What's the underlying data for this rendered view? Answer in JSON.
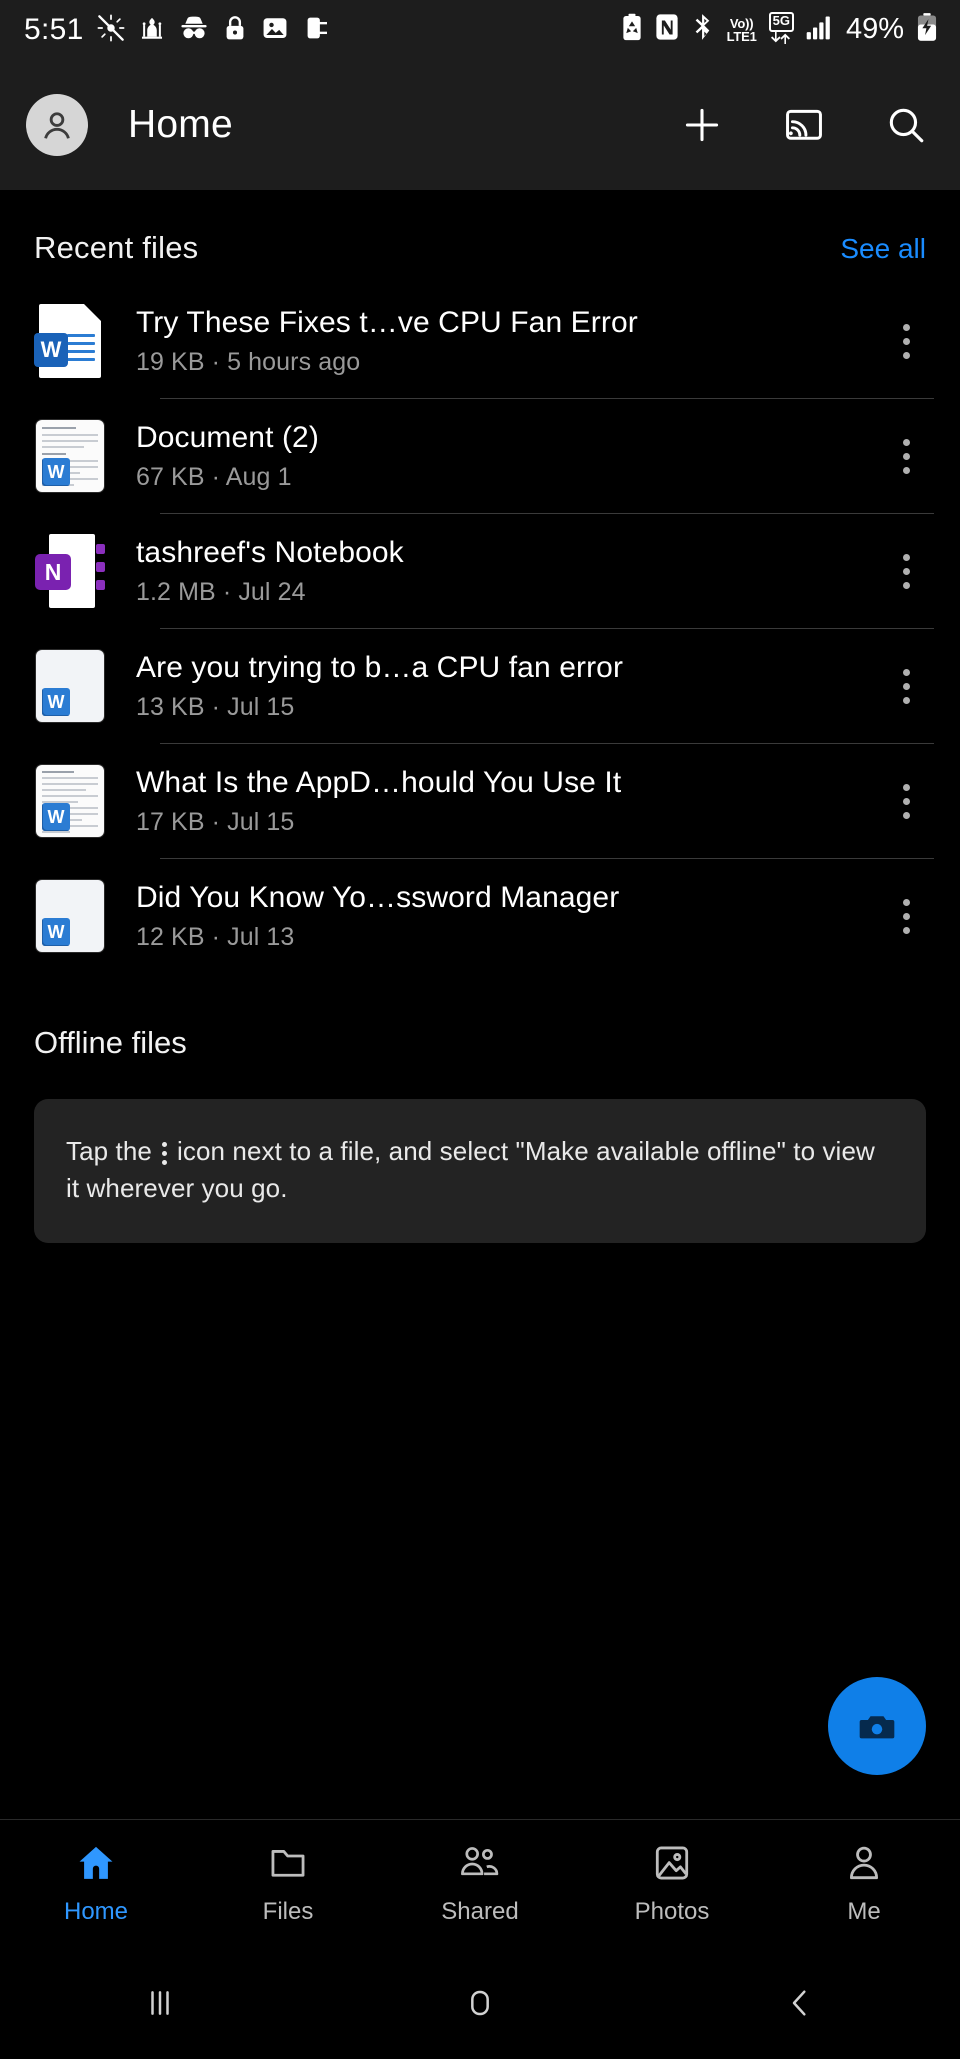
{
  "status_bar": {
    "time": "5:51",
    "battery_percent": "49%",
    "network_volte": "Vo))",
    "network_lte": "LTE1",
    "network_5g": "5G",
    "icons": [
      "do-not-disturb-icon",
      "mosque-icon",
      "incognito-icon",
      "lock-icon",
      "screenshot-icon",
      "phone-link-icon",
      "battery-saver-icon",
      "nfc-icon",
      "bluetooth-icon",
      "signal-bars-icon",
      "battery-charging-icon"
    ]
  },
  "app_bar": {
    "title": "Home",
    "avatar_name": "account-avatar",
    "actions": [
      "add-button",
      "cast-button",
      "search-button"
    ]
  },
  "recent": {
    "title": "Recent files",
    "see_all_label": "See all",
    "files": [
      {
        "name": "Try These Fixes t…ve CPU Fan Error",
        "size": "19 KB",
        "modified": "5 hours ago",
        "sub": "19 KB · 5 hours ago",
        "icon": "word-document-icon",
        "badge": "W"
      },
      {
        "name": "Document (2)",
        "size": "67 KB",
        "modified": "Aug 1",
        "sub": "67 KB · Aug 1",
        "icon": "word-thumbnail-icon",
        "badge": "W"
      },
      {
        "name": "tashreef's Notebook",
        "size": "1.2 MB",
        "modified": "Jul 24",
        "sub": "1.2 MB · Jul 24",
        "icon": "onenote-notebook-icon",
        "badge": "N"
      },
      {
        "name": "Are you trying to b…a CPU fan error",
        "size": "13 KB",
        "modified": "Jul 15",
        "sub": "13 KB · Jul 15",
        "icon": "word-thumbnail-icon",
        "badge": "W"
      },
      {
        "name": "What Is the AppD…hould You Use It",
        "size": "17 KB",
        "modified": "Jul 15",
        "sub": "17 KB · Jul 15",
        "icon": "word-thumbnail-icon",
        "badge": "W"
      },
      {
        "name": "Did You Know Yo…ssword Manager",
        "size": "12 KB",
        "modified": "Jul 13",
        "sub": "12 KB · Jul 13",
        "icon": "word-thumbnail-icon",
        "badge": "W"
      }
    ]
  },
  "offline": {
    "title": "Offline files",
    "hint_part1": "Tap the",
    "hint_part2": "icon next to a file, and select \"Make available offline\" to view it wherever you go."
  },
  "fab": {
    "name": "camera-upload-button"
  },
  "bottom_nav": {
    "items": [
      {
        "label": "Home",
        "icon": "home-icon",
        "active": true
      },
      {
        "label": "Files",
        "icon": "folder-icon",
        "active": false
      },
      {
        "label": "Shared",
        "icon": "people-icon",
        "active": false
      },
      {
        "label": "Photos",
        "icon": "photo-icon",
        "active": false
      },
      {
        "label": "Me",
        "icon": "person-icon",
        "active": false
      }
    ]
  },
  "system_nav": {
    "recents": "recents-button",
    "home": "home-button",
    "back": "back-button"
  },
  "colors": {
    "accent_blue": "#0f7fe8",
    "link_blue": "#1a8cff",
    "nav_active": "#2f97ff",
    "word_blue": "#2b7cd3",
    "onenote_purple": "#7a22b0",
    "surface": "#1d1d1d",
    "card": "#232323",
    "background": "#000000"
  }
}
